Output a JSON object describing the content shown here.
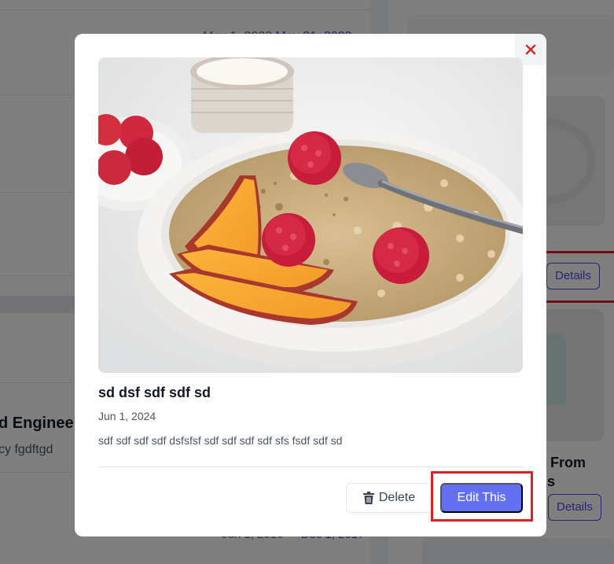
{
  "background": {
    "left": {
      "dates_top": "May 1, 2023",
      "dates_top_end": "May 31, 2023",
      "title_partial": "d Engineer",
      "subtitle_partial": "cy fgdftgd",
      "dates_bottom_start": "Jun 1, 2016",
      "dates_bottom_end": "Dec 1, 2017"
    },
    "right": {
      "details_label_1": "Details",
      "details_label_2": "Details",
      "card_title_line1": "From",
      "card_title_line2": "s"
    }
  },
  "modal": {
    "close_icon": "close-icon",
    "image_alt": "Oatmeal bowl with peach slices and raspberries",
    "title": "sd dsf sdf sdf sd",
    "date": "Jun 1, 2024",
    "body": "sdf sdf sdf sdf dsfsfsf sdf sdf sdf sdf sfs fsdf sdf sd",
    "delete_label": "Delete",
    "delete_icon": "trash-icon",
    "edit_label": "Edit This"
  },
  "colors": {
    "accent": "#6370f2",
    "highlight_box": "#e01f1f",
    "close_x": "#dc2626"
  }
}
